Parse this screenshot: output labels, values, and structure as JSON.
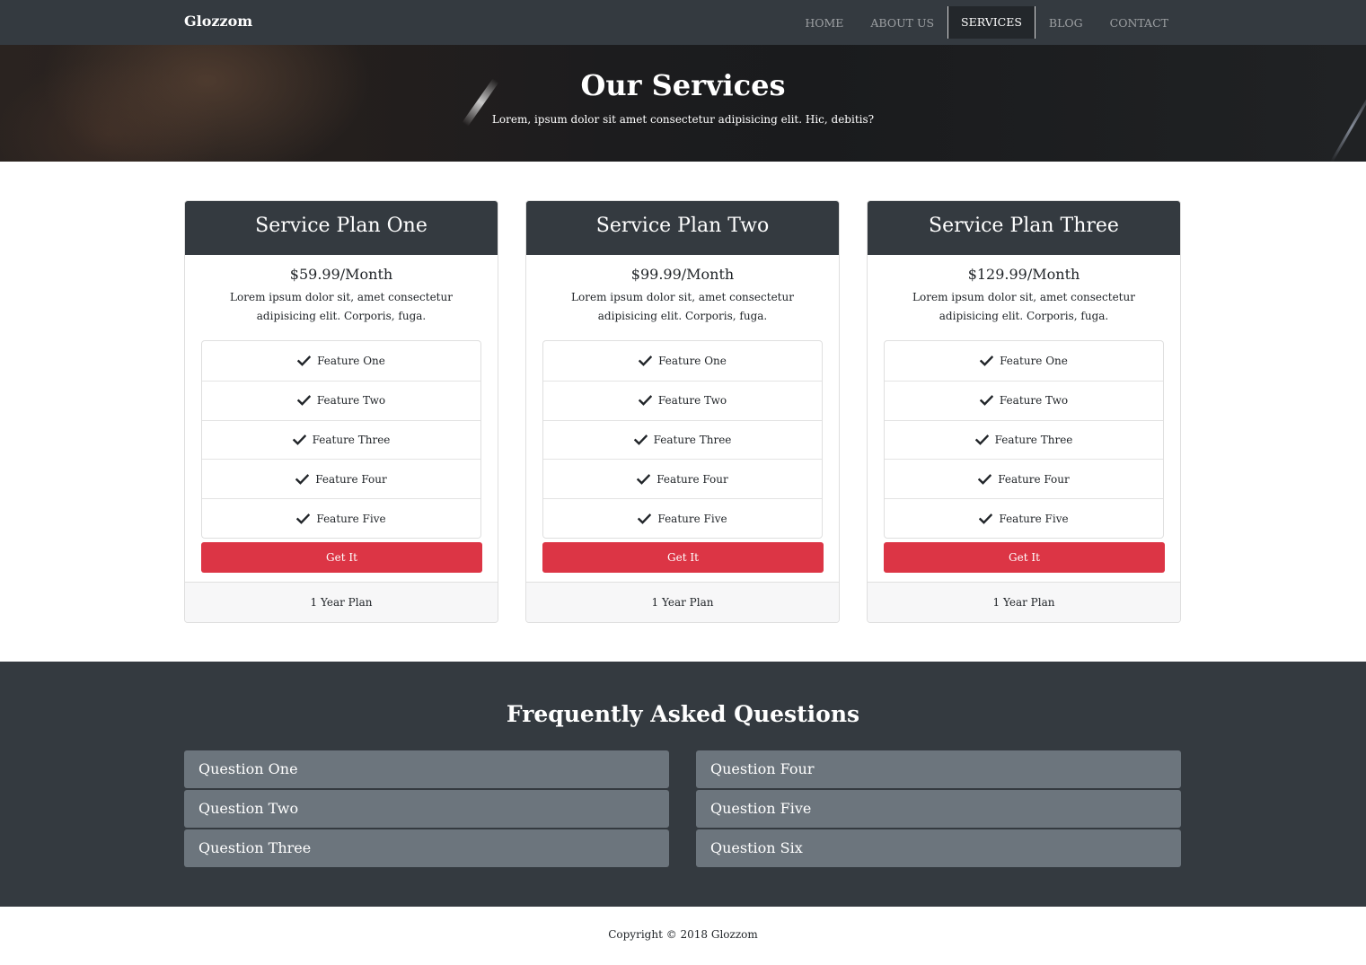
{
  "nav": {
    "brand": "Glozzom",
    "items": [
      {
        "label": "HOME"
      },
      {
        "label": "ABOUT US"
      },
      {
        "label": "SERVICES"
      },
      {
        "label": "BLOG"
      },
      {
        "label": "CONTACT"
      }
    ],
    "active": "SERVICES"
  },
  "hero": {
    "title": "Our Services",
    "subtitle": "Lorem, ipsum dolor sit amet consectetur adipisicing elit. Hic, debitis?"
  },
  "plans": [
    {
      "title": "Service Plan One",
      "price": "$59.99/Month",
      "description": "Lorem ipsum dolor sit, amet consectetur adipisicing elit. Corporis, fuga.",
      "features": [
        "Feature One",
        "Feature Two",
        "Feature Three",
        "Feature Four",
        "Feature Five"
      ],
      "button": "Get It",
      "footer": "1 Year Plan"
    },
    {
      "title": "Service Plan Two",
      "price": "$99.99/Month",
      "description": "Lorem ipsum dolor sit, amet consectetur adipisicing elit. Corporis, fuga.",
      "features": [
        "Feature One",
        "Feature Two",
        "Feature Three",
        "Feature Four",
        "Feature Five"
      ],
      "button": "Get It",
      "footer": "1 Year Plan"
    },
    {
      "title": "Service Plan Three",
      "price": "$129.99/Month",
      "description": "Lorem ipsum dolor sit, amet consectetur adipisicing elit. Corporis, fuga.",
      "features": [
        "Feature One",
        "Feature Two",
        "Feature Three",
        "Feature Four",
        "Feature Five"
      ],
      "button": "Get It",
      "footer": "1 Year Plan"
    }
  ],
  "faq": {
    "title": "Frequently Asked Questions",
    "left": [
      "Question One",
      "Question Two",
      "Question Three"
    ],
    "right": [
      "Question Four",
      "Question Five",
      "Question Six"
    ]
  },
  "footer": {
    "copyright": "Copyright © 2018 Glozzom"
  },
  "colors": {
    "navbar": "#343a40",
    "accent_button": "#dc3545",
    "faq_item": "#6c757d"
  },
  "icons": {
    "feature_check": "check-icon"
  }
}
